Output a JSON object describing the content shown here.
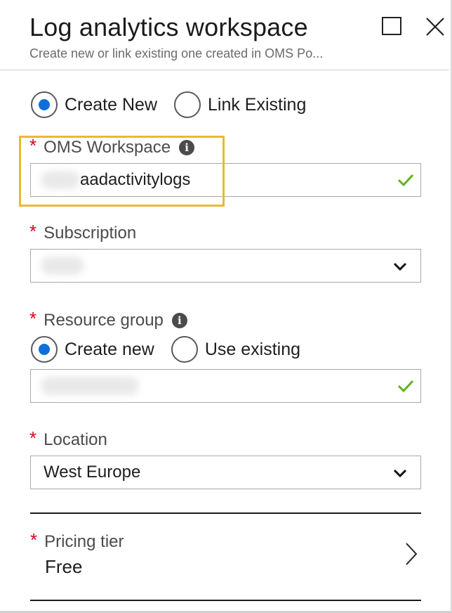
{
  "header": {
    "title": "Log analytics workspace",
    "subtitle": "Create new or link existing one created in OMS Po..."
  },
  "mode": {
    "options": [
      {
        "label": "Create New",
        "selected": true
      },
      {
        "label": "Link Existing",
        "selected": false
      }
    ]
  },
  "workspace": {
    "required_mark": "*",
    "label": "OMS Workspace",
    "value": "aadactivitylogs",
    "valid": true
  },
  "subscription": {
    "required_mark": "*",
    "label": "Subscription"
  },
  "resource_group": {
    "required_mark": "*",
    "label": "Resource group",
    "options": [
      {
        "label": "Create new",
        "selected": true
      },
      {
        "label": "Use existing",
        "selected": false
      }
    ],
    "valid": true
  },
  "location": {
    "required_mark": "*",
    "label": "Location",
    "value": "West Europe"
  },
  "pricing": {
    "required_mark": "*",
    "label": "Pricing tier",
    "value": "Free"
  },
  "colors": {
    "accent": "#0f6fd8",
    "required": "#e0001b",
    "valid": "#5fb319",
    "highlight": "#e8b934"
  },
  "icons": [
    "maximize-icon",
    "close-icon",
    "info-icon",
    "checkmark-icon",
    "chevron-down-icon",
    "chevron-right-icon"
  ]
}
